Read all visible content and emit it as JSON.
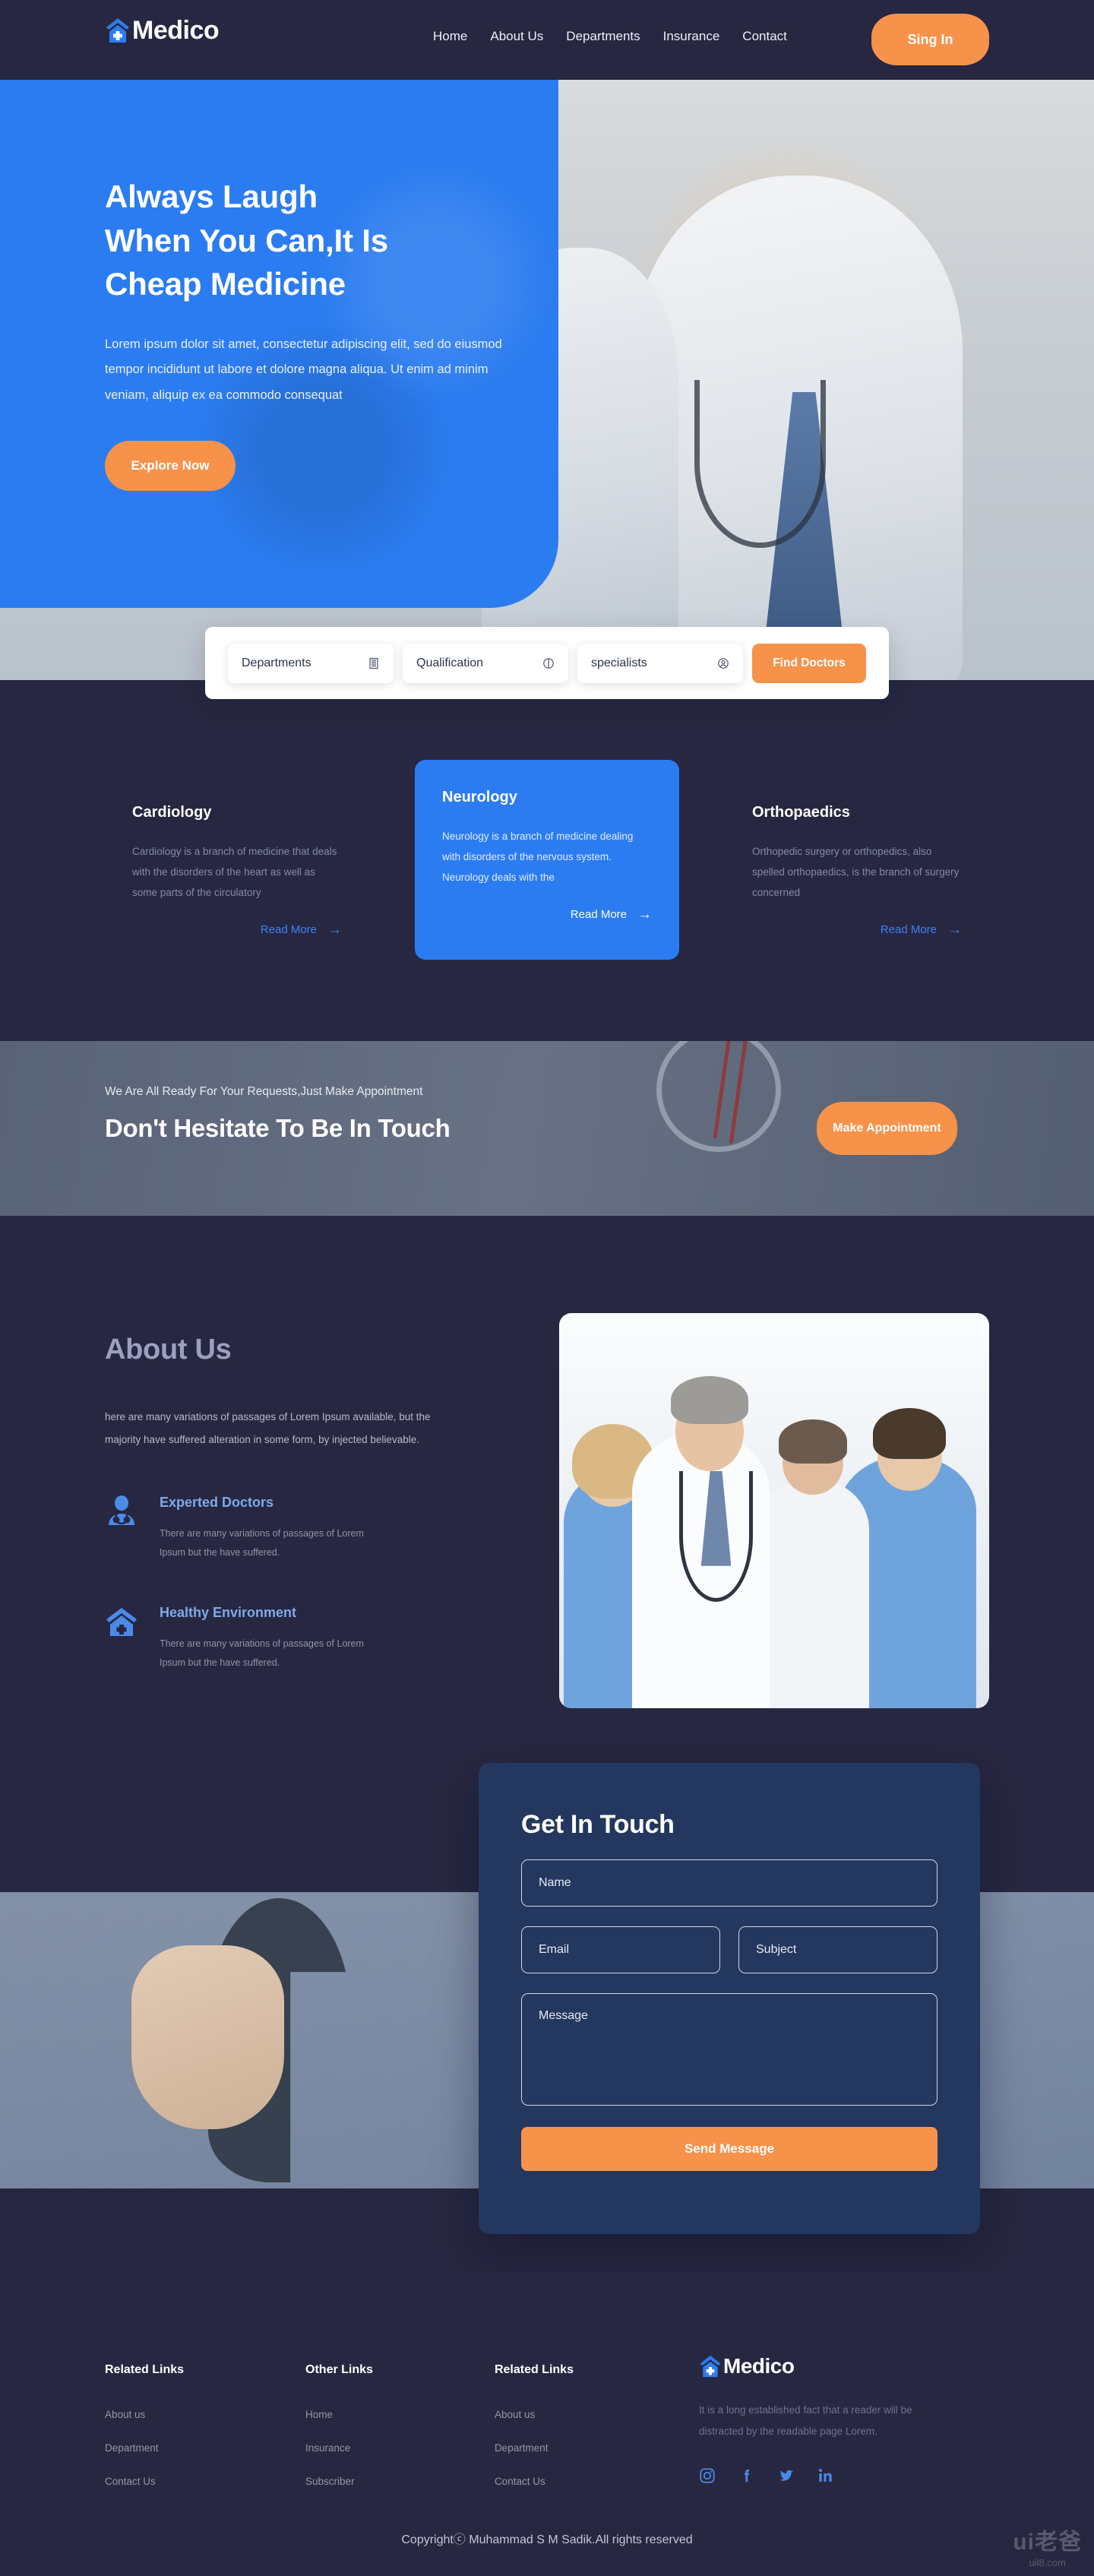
{
  "brand": {
    "name": "Medico",
    "icon": "hospital-home-icon"
  },
  "nav": {
    "items": [
      {
        "label": "Home"
      },
      {
        "label": "About Us"
      },
      {
        "label": "Departments"
      },
      {
        "label": "Insurance"
      },
      {
        "label": "Contact"
      }
    ],
    "signin_label": "Sing In"
  },
  "hero": {
    "title_line1": "Always Laugh",
    "title_line2": "When You Can,It Is",
    "title_line3": "Cheap Medicine",
    "paragraph": "Lorem ipsum dolor sit amet, consectetur adipiscing elit, sed do eiusmod tempor incididunt ut labore et dolore magna aliqua. Ut enim ad minim veniam, aliquip ex ea commodo consequat",
    "cta_label": "Explore Now"
  },
  "search": {
    "fields": [
      {
        "label": "Departments",
        "icon": "building-icon"
      },
      {
        "label": "Qualification",
        "icon": "certificate-icon"
      },
      {
        "label": "specialists",
        "icon": "user-circle-icon"
      }
    ],
    "button_label": "Find Doctors"
  },
  "departments": {
    "cards": [
      {
        "title": "Cardiology",
        "text": "Cardiology is a branch of medicine that deals with the disorders of the heart as well as some parts of the circulatory",
        "link_label": "Read More",
        "active": false
      },
      {
        "title": "Neurology",
        "text": "Neurology is a branch of medicine dealing with disorders of the nervous system. Neurology deals with the",
        "link_label": "Read More",
        "active": true
      },
      {
        "title": "Orthopaedics",
        "text": "Orthopedic surgery or orthopedics, also spelled orthopaedics, is the branch of surgery concerned",
        "link_label": "Read More",
        "active": false
      }
    ]
  },
  "cta": {
    "kicker": "We Are All Ready For Your Requests,Just Make Appointment",
    "title": "Don't Hesitate To Be In Touch",
    "button_label": "Make Appointment"
  },
  "about": {
    "title": "About Us",
    "paragraph": "here are many variations of passages of Lorem Ipsum available, but the majority have suffered alteration in some form, by injected believable.",
    "features": [
      {
        "icon": "doctor-stethoscope-icon",
        "title": "Experted Doctors",
        "text": "There are many variations of passages of Lorem Ipsum but the  have suffered."
      },
      {
        "icon": "hospital-home-icon",
        "title": "Healthy Environment",
        "text": "There are many variations of passages of Lorem Ipsum but the have suffered."
      }
    ],
    "photo_alt": "medical-team-photo"
  },
  "contact": {
    "title": "Get In Touch",
    "name_placeholder": "Name",
    "email_placeholder": "Email",
    "subject_placeholder": "Subject",
    "message_placeholder": "Message",
    "submit_label": "Send Message",
    "photo_alt": "doctor-with-stethoscope-photo"
  },
  "footer": {
    "columns": [
      {
        "heading": "Related Links",
        "links": [
          "About us",
          "Department",
          "Contact Us"
        ]
      },
      {
        "heading": "Other Links",
        "links": [
          "Home",
          "Insurance",
          "Subscriber"
        ]
      },
      {
        "heading": "Related Links",
        "links": [
          "About us",
          "Department",
          "Contact Us"
        ]
      }
    ],
    "brand_name": "Medico",
    "description": "It is a long established fact that a reader will be distracted by the readable  page  Lorem.",
    "social": [
      "instagram-icon",
      "facebook-icon",
      "twitter-icon",
      "linkedin-icon"
    ],
    "copyright": "Copyrightⓒ Muhammad S M Sadik.All rights reserved"
  },
  "watermark": {
    "main": "ui老爸",
    "sub": "uil8.com"
  },
  "colors": {
    "page_bg": "#272741",
    "primary_blue": "#2B7CF0",
    "accent_orange": "#F7924B",
    "form_card": "#24375E",
    "muted_text": "#858ba4"
  }
}
